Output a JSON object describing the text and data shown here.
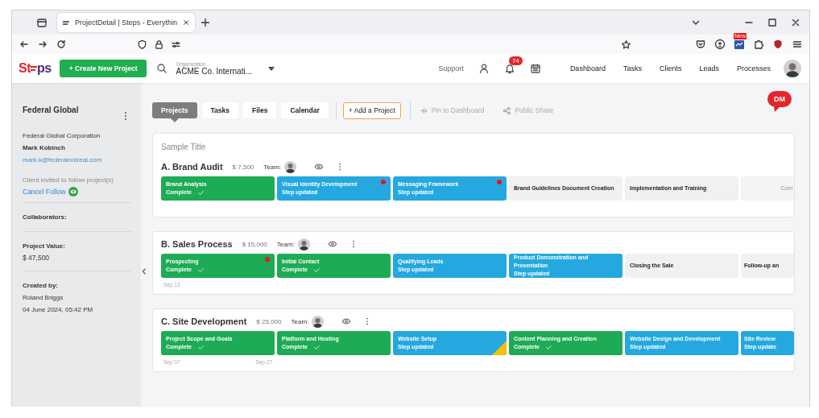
{
  "browser": {
    "tab_title": "ProjectDetail | Steps - Everythin",
    "extension_badge": "New"
  },
  "header": {
    "logo": [
      "St",
      "ps"
    ],
    "create_button": "+ Create New Project",
    "organization_label": "Organization",
    "organization": "ACME Co. Internati...",
    "support": "Support",
    "notifications": "74",
    "nav": [
      {
        "label": "Dashboard"
      },
      {
        "label": "Tasks"
      },
      {
        "label": "Clients"
      },
      {
        "label": "Leads"
      },
      {
        "label": "Processes"
      }
    ]
  },
  "sidebar": {
    "client": "Federal Global",
    "company": "Federal Global Corporation",
    "contact": "Mark Kobinch",
    "email": "mark.k@federalnotreal.com",
    "follow_note": "Client invited to follow project(s)",
    "cancel_follow": "Cancel Follow",
    "collaborators_label": "Collaborators:",
    "value_label": "Project Value:",
    "value": "$ 47,500",
    "created_label": "Created by:",
    "created_by": "Roland Briggs",
    "created_at": "04 June 2024, 05:42 PM"
  },
  "toolbar": {
    "tabs": [
      {
        "label": "Projects",
        "selected": true
      },
      {
        "label": "Tasks",
        "selected": false
      },
      {
        "label": "Files",
        "selected": false
      },
      {
        "label": "Calendar",
        "selected": false
      }
    ],
    "add_button": "+ Add a Project",
    "pin": "Pin to Dashboard",
    "share": "Public Share",
    "dm": "DM"
  },
  "projects": [
    {
      "section_title": "Sample Title",
      "title": "A. Brand Audit",
      "value": "$ 7,500",
      "team_label": "Team:",
      "steps": [
        {
          "name": "Brand Analysis",
          "kind": "complete",
          "status": "Complete",
          "alert": false,
          "flag": false
        },
        {
          "name": "Visual Identity Development",
          "kind": "updated",
          "status": "Step updated",
          "alert": true,
          "flag": false
        },
        {
          "name": "Messaging Framework",
          "kind": "updated",
          "status": "Step updated",
          "alert": true,
          "flag": false
        },
        {
          "name": "Brand Guidelines Document Creation",
          "kind": "pending",
          "alert": false,
          "flag": false
        },
        {
          "name": "Implementation and Training",
          "kind": "pending",
          "alert": false,
          "flag": false
        },
        {
          "name": "Com",
          "kind": "faded",
          "alert": false,
          "flag": false
        }
      ]
    },
    {
      "title": "B. Sales Process",
      "value": "$ 15,000",
      "team_label": "Team:",
      "steps": [
        {
          "name": "Prospecting",
          "kind": "complete",
          "status": "Complete",
          "alert": true,
          "flag": false,
          "start_date": "Sep 13"
        },
        {
          "name": "Initial Contact",
          "kind": "complete",
          "status": "Complete",
          "alert": false,
          "flag": false
        },
        {
          "name": "Qualifying Leads",
          "kind": "updated",
          "status": "Step updated",
          "alert": false,
          "flag": false
        },
        {
          "name": "Product Demonstration and Presentation",
          "kind": "updated",
          "status": "Step updated",
          "alert": false,
          "flag": false
        },
        {
          "name": "Closing the Sale",
          "kind": "pending",
          "alert": false,
          "flag": false
        },
        {
          "name": "Follow-up an",
          "kind": "pending",
          "alert": false,
          "flag": false
        }
      ]
    },
    {
      "title": "C. Site Development",
      "value": "$ 25,000",
      "team_label": "Team:",
      "steps": [
        {
          "name": "Project Scope and Goals",
          "kind": "complete",
          "status": "Complete",
          "alert": false,
          "flag": false,
          "start_date": "Sep 07",
          "end_date": "Sep 27"
        },
        {
          "name": "Platform and Hosting",
          "kind": "complete",
          "status": "Complete",
          "alert": false,
          "flag": false
        },
        {
          "name": "Website Setup",
          "kind": "updated",
          "status": "Step updated",
          "alert": false,
          "flag": true
        },
        {
          "name": "Content Planning and Creation",
          "kind": "complete",
          "status": "Complete",
          "alert": false,
          "flag": false
        },
        {
          "name": "Website Design and Development",
          "kind": "updated",
          "status": "Step updated",
          "alert": false,
          "flag": false
        },
        {
          "name": "Site Review",
          "kind": "updated",
          "status": "Step update",
          "alert": false,
          "flag": false
        }
      ]
    }
  ]
}
